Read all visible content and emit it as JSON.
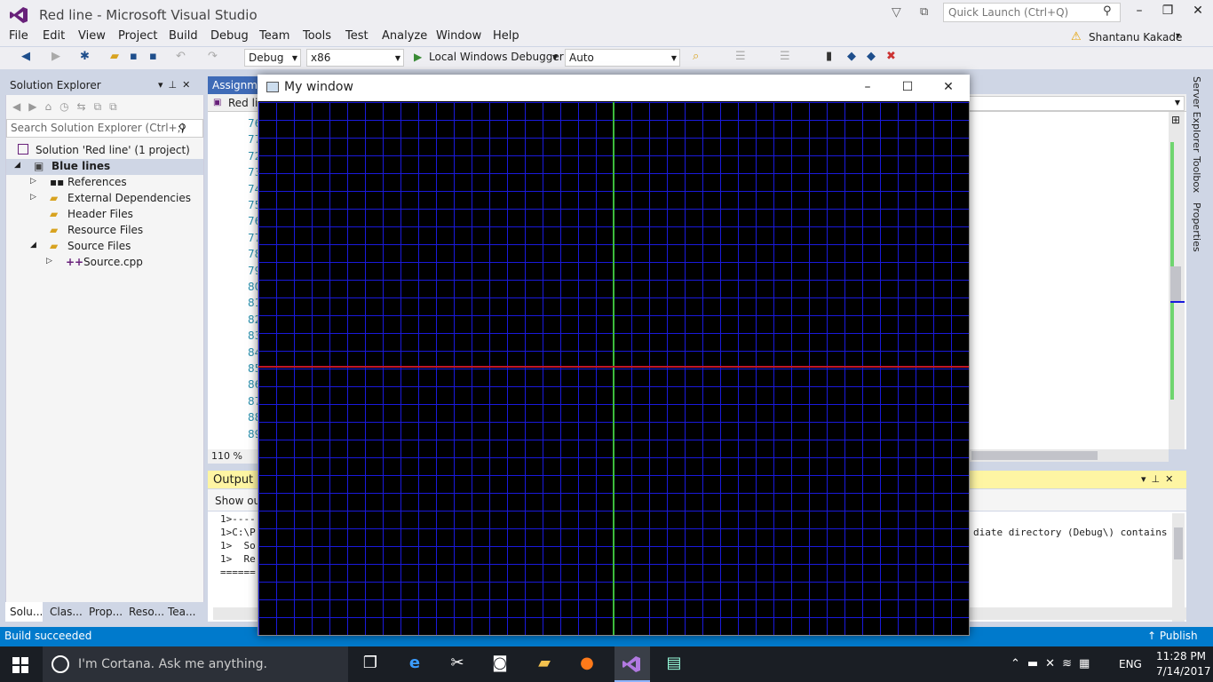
{
  "title_bar": {
    "title": "Red line - Microsoft Visual Studio",
    "quick_launch_placeholder": "Quick Launch (Ctrl+Q)"
  },
  "menu": [
    "File",
    "Edit",
    "View",
    "Project",
    "Build",
    "Debug",
    "Team",
    "Tools",
    "Test",
    "Analyze",
    "Window",
    "Help"
  ],
  "user": {
    "name": "Shantanu Kakade"
  },
  "toolbar": {
    "config": "Debug",
    "platform": "x86",
    "debugger": "Local Windows Debugger",
    "mode": "Auto"
  },
  "solution_explorer": {
    "title": "Solution Explorer",
    "search_placeholder": "Search Solution Explorer (Ctrl+;)",
    "solution": "Solution 'Red line' (1 project)",
    "project": "Blue lines",
    "items": [
      "References",
      "External Dependencies",
      "Header Files",
      "Resource Files",
      "Source Files",
      "Source.cpp"
    ],
    "tabs": [
      "Solu...",
      "Clas...",
      "Prop...",
      "Reso...",
      "Tea..."
    ]
  },
  "editor": {
    "tab": "Assignme",
    "nav_file": "Red lin",
    "line_numbers": [
      "76",
      "77",
      "72",
      "73",
      "74",
      "75",
      "76",
      "77",
      "78",
      "79",
      "80",
      "81",
      "82",
      "83",
      "84",
      "85",
      "86",
      "87",
      "88",
      "89"
    ],
    "zoom": "110 %"
  },
  "output": {
    "title": "Output",
    "show_label": "Show out",
    "lines": [
      "1>----",
      "1>C:\\P",
      "1>  So",
      "1>  Re",
      "======"
    ],
    "right_text": "diate directory (Debug\\) contains"
  },
  "status": {
    "text": "Build succeeded",
    "publish": "Publish"
  },
  "side_tabs": [
    "Server Explorer",
    "Toolbox",
    "Properties"
  ],
  "my_window": {
    "title": "My window",
    "colors": {
      "background": "#000000",
      "grid": "#1a1adc",
      "axis_x": "#c0162a",
      "axis_y": "#3dbb3d"
    }
  },
  "taskbar": {
    "cortana": "I'm Cortana. Ask me anything.",
    "time": "11:28 PM",
    "date": "7/14/2017",
    "lang": "ENG"
  }
}
